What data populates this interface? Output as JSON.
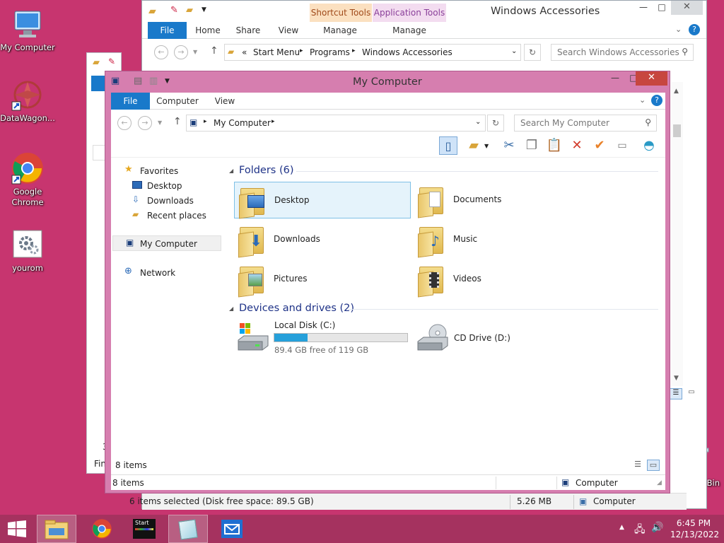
{
  "desktop": {
    "icons": [
      {
        "label": "My Computer"
      },
      {
        "label": "DataWagon..."
      },
      {
        "label": "Google Chrome"
      },
      {
        "label": "yourom"
      },
      {
        "label": "le Bin"
      }
    ]
  },
  "window_accessories": {
    "title": "Windows Accessories",
    "context_tabs": {
      "shortcut_tools": "Shortcut Tools",
      "application_tools": "Application Tools"
    },
    "tabs": [
      "File",
      "Home",
      "Share",
      "View",
      "Manage",
      "Manage"
    ],
    "address": {
      "prefix": "«",
      "crumbs": [
        "Start Menu",
        "Programs",
        "Windows Accessories"
      ]
    },
    "search_placeholder": "Search Windows Accessories",
    "status": {
      "selected": "6 items selected (Disk free space: 89.5 GB)",
      "size": "5.26 MB",
      "location": "Computer"
    }
  },
  "window_bg_partial": {
    "status_fragment_1": "3",
    "status_fragment_2": "Fin"
  },
  "my_computer": {
    "title": "My Computer",
    "tabs": [
      "File",
      "Computer",
      "View"
    ],
    "address": {
      "crumbs": [
        "My Computer"
      ]
    },
    "search_placeholder": "Search My Computer",
    "nav": {
      "favorites": "Favorites",
      "favorites_items": [
        "Desktop",
        "Downloads",
        "Recent places"
      ],
      "my_computer": "My Computer",
      "network": "Network"
    },
    "folders_header": "Folders (6)",
    "folders": [
      "Desktop",
      "Documents",
      "Downloads",
      "Music",
      "Pictures",
      "Videos"
    ],
    "drives_header": "Devices and drives (2)",
    "drives": [
      {
        "name": "Local Disk (C:)",
        "free": "89.4 GB free of 119 GB",
        "used_fraction": 0.25
      },
      {
        "name": "CD Drive (D:)"
      }
    ],
    "inner_status": "8 items",
    "status": {
      "items": "8 items",
      "location": "Computer"
    }
  },
  "taskbar": {
    "start_tile_label": "Start",
    "clock": {
      "time": "6:45 PM",
      "date": "12/13/2022"
    }
  },
  "colors": {
    "desktop": "#c7356f",
    "frame": "#d67eaf",
    "accent": "#1979ca",
    "taskbar": "#a5325f"
  }
}
